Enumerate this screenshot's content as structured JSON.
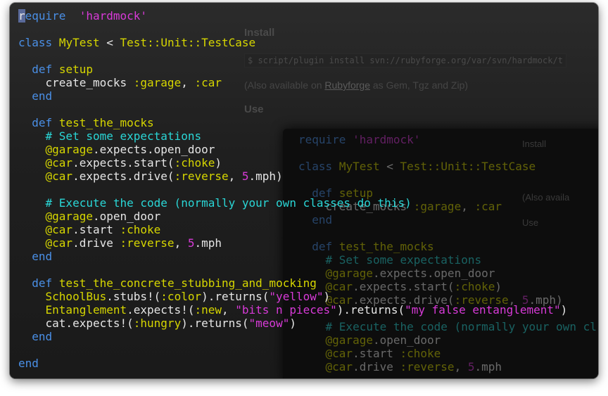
{
  "background_page": {
    "install_heading": "Install",
    "install_command": "$ script/plugin install svn://rubyforge.org/var/svn/hardmock/t",
    "also_available_prefix": "(Also available on ",
    "also_available_link": "Rubyforge",
    "also_available_suffix": " as Gem, Tgz and Zip)",
    "use_heading": "Use",
    "side_labels": [
      "Install",
      "(Also availa",
      "Use"
    ]
  },
  "terminal": {
    "lines": [
      [
        [
          "kw",
          "require"
        ],
        [
          "",
          "  "
        ],
        [
          "str",
          "'hardmock'"
        ]
      ],
      [],
      [
        [
          "kw",
          "class"
        ],
        [
          "",
          " "
        ],
        [
          "cls",
          "MyTest"
        ],
        [
          "",
          " "
        ],
        [
          "",
          "<"
        ],
        [
          "",
          " "
        ],
        [
          "cls",
          "Test::Unit::TestCase"
        ]
      ],
      [],
      [
        [
          "",
          "  "
        ],
        [
          "kw",
          "def"
        ],
        [
          "",
          " "
        ],
        [
          "cls",
          "setup"
        ]
      ],
      [
        [
          "",
          "    create_mocks "
        ],
        [
          "sym",
          ":garage"
        ],
        [
          "",
          ", "
        ],
        [
          "sym",
          ":car"
        ]
      ],
      [
        [
          "",
          "  "
        ],
        [
          "kw",
          "end"
        ]
      ],
      [],
      [
        [
          "",
          "  "
        ],
        [
          "kw",
          "def"
        ],
        [
          "",
          " "
        ],
        [
          "cls",
          "test_the_mocks"
        ]
      ],
      [
        [
          "",
          "    "
        ],
        [
          "cmt",
          "# Set some expectations"
        ]
      ],
      [
        [
          "",
          "    "
        ],
        [
          "ivar",
          "@garage"
        ],
        [
          "",
          ".expects.open_door"
        ]
      ],
      [
        [
          "",
          "    "
        ],
        [
          "ivar",
          "@car"
        ],
        [
          "",
          ".expects.start("
        ],
        [
          "sym",
          ":choke"
        ],
        [
          "",
          ")"
        ]
      ],
      [
        [
          "",
          "    "
        ],
        [
          "ivar",
          "@car"
        ],
        [
          "",
          ".expects.drive("
        ],
        [
          "sym",
          ":reverse"
        ],
        [
          "",
          ", "
        ],
        [
          "num",
          "5"
        ],
        [
          "",
          ".mph)"
        ]
      ],
      [],
      [
        [
          "",
          "    "
        ],
        [
          "cmt",
          "# Execute the code (normally your own classes do this)"
        ]
      ],
      [
        [
          "",
          "    "
        ],
        [
          "ivar",
          "@garage"
        ],
        [
          "",
          ".open_door"
        ]
      ],
      [
        [
          "",
          "    "
        ],
        [
          "ivar",
          "@car"
        ],
        [
          "",
          ".start "
        ],
        [
          "sym",
          ":choke"
        ]
      ],
      [
        [
          "",
          "    "
        ],
        [
          "ivar",
          "@car"
        ],
        [
          "",
          ".drive "
        ],
        [
          "sym",
          ":reverse"
        ],
        [
          "",
          ", "
        ],
        [
          "num",
          "5"
        ],
        [
          "",
          ".mph"
        ]
      ],
      [
        [
          "",
          "  "
        ],
        [
          "kw",
          "end"
        ]
      ],
      [],
      [
        [
          "",
          "  "
        ],
        [
          "kw",
          "def"
        ],
        [
          "",
          " "
        ],
        [
          "cls",
          "test_the_concrete_stubbing_and_mocking"
        ]
      ],
      [
        [
          "",
          "    "
        ],
        [
          "cls",
          "SchoolBus"
        ],
        [
          "",
          ".stubs!("
        ],
        [
          "sym",
          ":color"
        ],
        [
          "",
          ").returns("
        ],
        [
          "str",
          "\"yellow\""
        ],
        [
          "",
          ")"
        ]
      ],
      [
        [
          "",
          "    "
        ],
        [
          "cls",
          "Entanglement"
        ],
        [
          "",
          ".expects!("
        ],
        [
          "sym",
          ":new"
        ],
        [
          "",
          ", "
        ],
        [
          "str",
          "\"bits n pieces\""
        ],
        [
          "",
          ").returns("
        ],
        [
          "str",
          "\"my false entanglement\""
        ],
        [
          "",
          ")"
        ]
      ],
      [
        [
          "",
          "    cat.expects!("
        ],
        [
          "sym",
          ":hungry"
        ],
        [
          "",
          ").returns("
        ],
        [
          "str",
          "\"meow\""
        ],
        [
          "",
          ")"
        ]
      ],
      [
        [
          "",
          "  "
        ],
        [
          "kw",
          "end"
        ]
      ],
      [],
      [
        [
          "kw",
          "end"
        ]
      ]
    ]
  },
  "terminal_back": {
    "lines": [
      [
        [
          "kw",
          "require"
        ],
        [
          "",
          " "
        ],
        [
          "str",
          "'hardmock'"
        ]
      ],
      [],
      [
        [
          "kw",
          "class"
        ],
        [
          "",
          " "
        ],
        [
          "cls",
          "MyTest"
        ],
        [
          "",
          " < "
        ],
        [
          "cls",
          "Test::Unit::TestCase"
        ]
      ],
      [],
      [
        [
          "",
          "  "
        ],
        [
          "kw",
          "def"
        ],
        [
          "",
          " "
        ],
        [
          "cls",
          "setup"
        ]
      ],
      [
        [
          "",
          "    create_mocks "
        ],
        [
          "sym",
          ":garage"
        ],
        [
          "",
          ", "
        ],
        [
          "sym",
          ":car"
        ]
      ],
      [
        [
          "",
          "  "
        ],
        [
          "kw",
          "end"
        ]
      ],
      [],
      [
        [
          "",
          "  "
        ],
        [
          "kw",
          "def"
        ],
        [
          "",
          " "
        ],
        [
          "cls",
          "test_the_mocks"
        ]
      ],
      [
        [
          "",
          "    "
        ],
        [
          "cmt",
          "# Set some expectations"
        ]
      ],
      [
        [
          "",
          "    "
        ],
        [
          "ivar",
          "@garage"
        ],
        [
          "",
          ".expects.open_door"
        ]
      ],
      [
        [
          "",
          "    "
        ],
        [
          "ivar",
          "@car"
        ],
        [
          "",
          ".expects.start("
        ],
        [
          "sym",
          ":choke"
        ],
        [
          "",
          ")"
        ]
      ],
      [
        [
          "",
          "    "
        ],
        [
          "ivar",
          "@car"
        ],
        [
          "",
          ".expects.drive("
        ],
        [
          "sym",
          ":reverse"
        ],
        [
          "",
          ", "
        ],
        [
          "num",
          "5"
        ],
        [
          "",
          ".mph)"
        ]
      ],
      [],
      [
        [
          "",
          "    "
        ],
        [
          "cmt",
          "# Execute the code (normally your own cl"
        ]
      ],
      [
        [
          "",
          "    "
        ],
        [
          "ivar",
          "@garage"
        ],
        [
          "",
          ".open_door"
        ]
      ],
      [
        [
          "",
          "    "
        ],
        [
          "ivar",
          "@car"
        ],
        [
          "",
          ".start "
        ],
        [
          "sym",
          ":choke"
        ]
      ],
      [
        [
          "",
          "    "
        ],
        [
          "ivar",
          "@car"
        ],
        [
          "",
          ".drive "
        ],
        [
          "sym",
          ":reverse"
        ],
        [
          "",
          ", "
        ],
        [
          "num",
          "5"
        ],
        [
          "",
          ".mph"
        ]
      ]
    ]
  },
  "colors": {
    "keyword": "#4a8fe6",
    "constant": "#d6d600",
    "string": "#d83ad8",
    "comment": "#2ad6d6",
    "text": "#e6e6e6",
    "background": "#151515"
  }
}
